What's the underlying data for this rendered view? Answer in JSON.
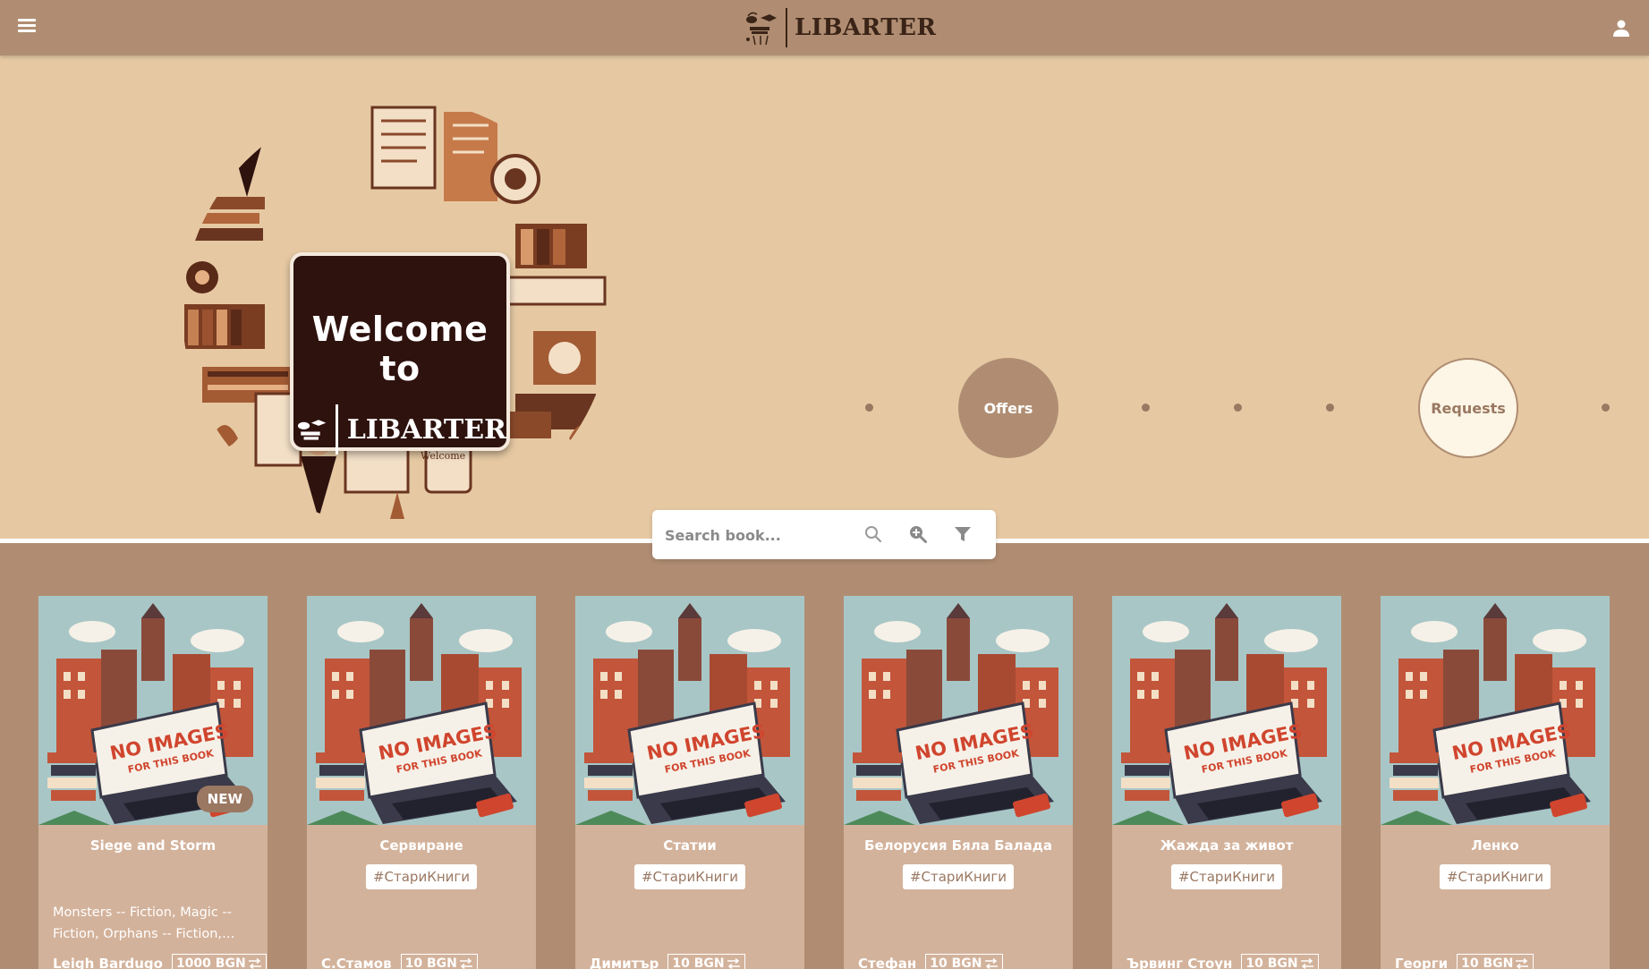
{
  "header": {
    "brand": "LIBARTER",
    "icons": {
      "menu": "hamburger-menu-icon",
      "user": "user-icon",
      "logo": "coffee-books-logo-icon"
    }
  },
  "hero": {
    "welcome_title": "Welcome to",
    "welcome_brand": "LIBARTER",
    "board_label": "Welcome",
    "offers_label": "Offers",
    "requests_label": "Requests"
  },
  "search": {
    "placeholder": "Search book...",
    "icons": [
      "search-icon",
      "zoom-in-icon",
      "filter-icon"
    ]
  },
  "colors": {
    "header_bg": "#b08d72",
    "hero_bg": "#e6c9a3",
    "card_bg": "#d3b29b",
    "board_bg": "#2e120e",
    "requests_bg": "#fdf6e6"
  },
  "cards": [
    {
      "title": "Siege and Storm",
      "badge": "NEW",
      "tag": "",
      "description": "Monsters -- Fiction, Magic -- Fiction, Orphans -- Fiction,…",
      "author": "Leigh Bardugo",
      "price": "1000 BGN"
    },
    {
      "title": "Сервиране",
      "badge": "",
      "tag": "#СтариКниги",
      "description": "",
      "author": "С.Стамов",
      "price": "10 BGN"
    },
    {
      "title": "Статии",
      "badge": "",
      "tag": "#СтариКниги",
      "description": "",
      "author": "Димитър",
      "price": "10 BGN"
    },
    {
      "title": "Белорусия Бяла Балада",
      "badge": "",
      "tag": "#СтариКниги",
      "description": "",
      "author": "Стефан",
      "price": "10 BGN"
    },
    {
      "title": "Жажда за живот",
      "badge": "",
      "tag": "#СтариКниги",
      "description": "",
      "author": "Ървинг Стоун",
      "price": "10 BGN"
    },
    {
      "title": "Ленко",
      "badge": "",
      "tag": "#СтариКниги",
      "description": "",
      "author": "Георги",
      "price": "10 BGN"
    }
  ],
  "card_image_text": {
    "line1": "NO IMAGES",
    "line2": "FOR THIS BOOK"
  }
}
